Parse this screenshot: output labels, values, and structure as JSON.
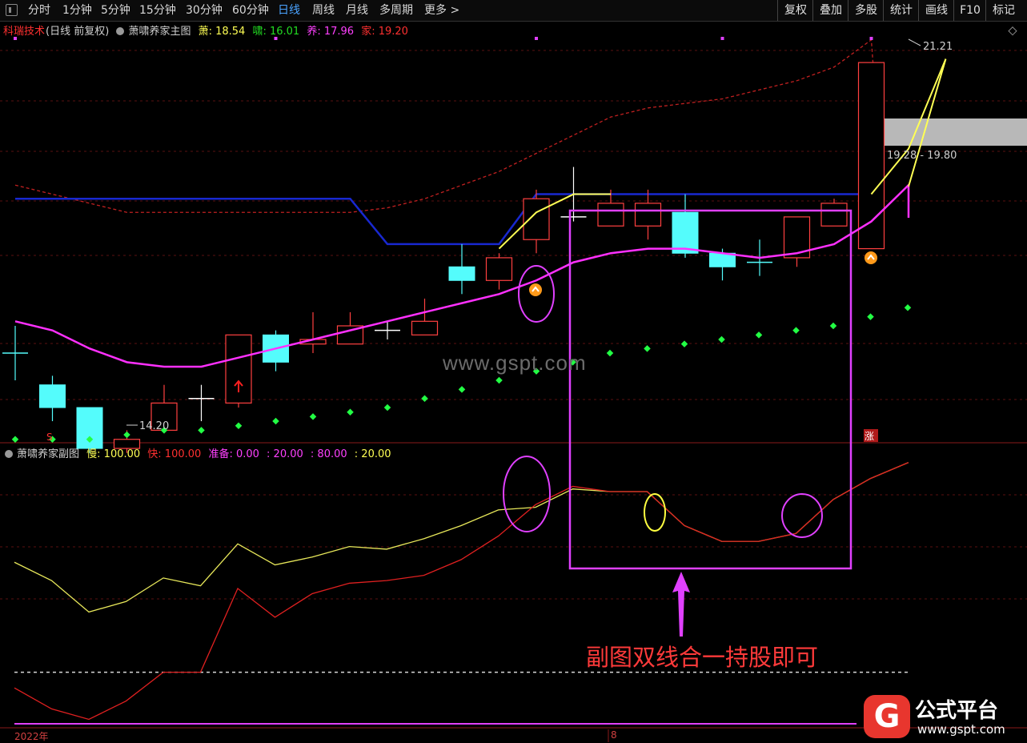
{
  "toolbar": {
    "periods": [
      "分时",
      "1分钟",
      "5分钟",
      "15分钟",
      "30分钟",
      "60分钟",
      "日线",
      "周线",
      "月线",
      "多周期",
      "更多 >"
    ],
    "active_period": "日线",
    "right_buttons": [
      "复权",
      "叠加",
      "多股",
      "统计",
      "画线",
      "F10",
      "标记"
    ]
  },
  "main_legend": {
    "stock": "科瑞技术",
    "mode": "(日线 前复权)",
    "indicator": "萧啸养家主图",
    "xiao1": "萧: 18.54",
    "xiao2": "啸: 16.01",
    "yang": "养: 17.96",
    "jia": "家: 19.20"
  },
  "sub_legend": {
    "indicator": "萧啸养家副图",
    "slow": "慢: 100.00",
    "fast": "快: 100.00",
    "ready": "准备: 0.00",
    "v20a": ": 20.00",
    "v80": ": 80.00",
    "v20b": ": 20.00"
  },
  "price_labels": {
    "high": "21.21",
    "low": "14.20",
    "range": "19.28 - 19.80"
  },
  "markers": {
    "zhang": "涨",
    "s": "S"
  },
  "annotation": "副图双线合一持股即可",
  "watermark": "www.gspt.com",
  "logo": {
    "icon": "G",
    "name": "公式平台",
    "url": "www.gspt.com"
  },
  "dates": {
    "year": "2022年",
    "month": "8"
  },
  "colors": {
    "up": "#ff4040",
    "down": "#54fcfc",
    "yang_line": "#ff30ff",
    "xiao_line": "#ffff54",
    "blue_line": "#1828d0",
    "green_dots": "#22ff44",
    "purple_box": "#e040ff"
  },
  "candles": [
    {
      "o": 15.3,
      "c": 15.3,
      "h": 15.6,
      "l": 15.0
    },
    {
      "o": 14.95,
      "c": 14.7,
      "h": 15.05,
      "l": 14.55
    },
    {
      "o": 14.7,
      "c": 14.25,
      "h": 14.7,
      "l": 14.2
    },
    {
      "o": 14.25,
      "c": 14.35,
      "h": 14.45,
      "l": 14.2
    },
    {
      "o": 14.45,
      "c": 14.75,
      "h": 14.95,
      "l": 14.45
    },
    {
      "o": 14.8,
      "c": 14.8,
      "h": 14.95,
      "l": 14.55
    },
    {
      "o": 14.75,
      "c": 15.5,
      "h": 15.5,
      "l": 14.7
    },
    {
      "o": 15.5,
      "c": 15.2,
      "h": 15.55,
      "l": 15.1
    },
    {
      "o": 15.4,
      "c": 15.45,
      "h": 15.75,
      "l": 15.3
    },
    {
      "o": 15.4,
      "c": 15.6,
      "h": 15.75,
      "l": 15.4
    },
    {
      "o": 15.55,
      "c": 15.55,
      "h": 15.65,
      "l": 15.45
    },
    {
      "o": 15.5,
      "c": 15.65,
      "h": 15.9,
      "l": 15.5
    },
    {
      "o": 16.25,
      "c": 16.1,
      "h": 16.5,
      "l": 15.95
    },
    {
      "o": 16.1,
      "c": 16.35,
      "h": 16.4,
      "l": 16.0
    },
    {
      "o": 16.55,
      "c": 17.0,
      "h": 17.1,
      "l": 16.4
    },
    {
      "o": 16.8,
      "c": 16.8,
      "h": 17.35,
      "l": 16.75
    },
    {
      "o": 16.7,
      "c": 16.95,
      "h": 17.1,
      "l": 16.7
    },
    {
      "o": 16.7,
      "c": 16.95,
      "h": 17.1,
      "l": 16.55
    },
    {
      "o": 16.85,
      "c": 16.4,
      "h": 17.05,
      "l": 16.35
    },
    {
      "o": 16.4,
      "c": 16.25,
      "h": 16.45,
      "l": 16.1
    },
    {
      "o": 16.3,
      "c": 16.3,
      "h": 16.55,
      "l": 16.15
    },
    {
      "o": 16.35,
      "c": 16.8,
      "h": 16.8,
      "l": 16.25
    },
    {
      "o": 16.7,
      "c": 16.95,
      "h": 17.0,
      "l": 16.7
    },
    {
      "o": 16.45,
      "c": 18.5,
      "h": 18.5,
      "l": 16.45
    },
    {
      "o": 20.3,
      "c": 21.21,
      "h": 21.21,
      "l": 20.15
    }
  ],
  "yang_line": [
    15.65,
    15.55,
    15.35,
    15.2,
    15.15,
    15.15,
    15.25,
    15.35,
    15.45,
    15.55,
    15.65,
    15.75,
    15.85,
    15.95,
    16.1,
    16.3,
    16.4,
    16.45,
    16.45,
    16.4,
    16.35,
    16.4,
    16.5,
    16.75,
    17.15
  ],
  "xiao_line": {
    "start": 13,
    "values": [
      16.45,
      16.85,
      17.05,
      17.05,
      null,
      null,
      null,
      null,
      null,
      null,
      17.05,
      17.55,
      18.54
    ]
  },
  "blue_line": [
    17.0,
    17.0,
    17.0,
    17.0,
    17.0,
    17.0,
    17.0,
    17.0,
    17.0,
    17.0,
    16.5,
    16.5,
    16.5,
    16.5,
    17.05,
    17.05,
    17.05,
    17.05,
    17.05,
    17.05,
    17.05,
    17.05,
    17.05,
    17.05,
    null
  ],
  "dashed_line": [
    17.15,
    17.05,
    16.95,
    16.85,
    16.85,
    16.85,
    16.85,
    16.85,
    16.85,
    16.85,
    16.9,
    17.0,
    17.15,
    17.3,
    17.5,
    17.7,
    17.9,
    18.0,
    18.05,
    18.1,
    18.2,
    18.3,
    18.45,
    18.75,
    null
  ],
  "green_dots": [
    14.35,
    14.35,
    14.35,
    14.4,
    14.45,
    14.45,
    14.5,
    14.55,
    14.6,
    14.65,
    14.7,
    14.8,
    14.9,
    15.0,
    15.1,
    15.2,
    15.3,
    15.35,
    15.4,
    15.45,
    15.5,
    15.55,
    15.6,
    15.7,
    15.8
  ],
  "top_dots": [
    0,
    7,
    14,
    19,
    23
  ],
  "sub": {
    "slow": [
      62,
      55,
      43,
      47,
      56,
      53,
      69,
      61,
      64,
      68,
      67,
      71,
      76,
      82,
      83,
      90,
      89,
      89,
      76,
      70,
      70,
      73,
      86,
      94,
      100,
      100
    ],
    "fast": [
      14,
      6,
      2,
      9,
      20,
      20,
      52,
      41,
      50,
      54,
      55,
      57,
      63,
      72,
      84,
      91,
      89,
      89,
      76,
      70,
      70,
      73,
      86,
      94,
      100,
      100
    ]
  }
}
